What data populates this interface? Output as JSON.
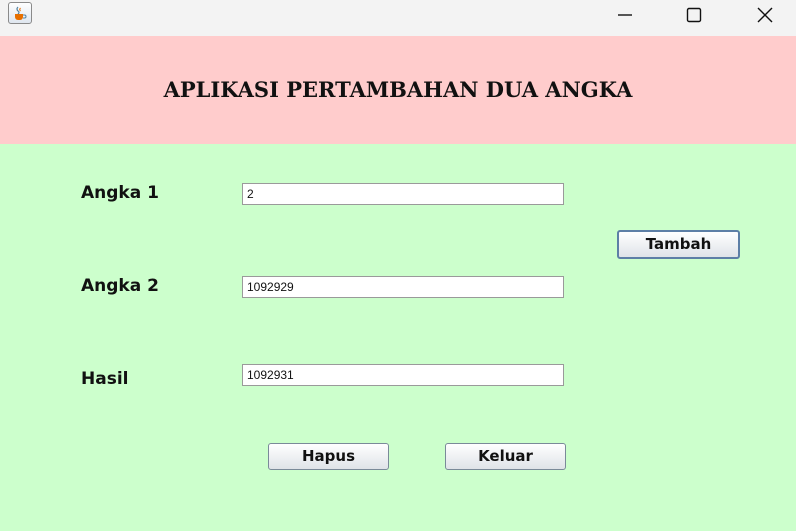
{
  "window": {
    "app_icon": "java-coffee-icon",
    "minimize_icon": "minimize-icon",
    "maximize_icon": "maximize-icon",
    "close_icon": "close-icon"
  },
  "header": {
    "title": "APLIKASI PERTAMBAHAN DUA ANGKA",
    "background": "#ffcccc"
  },
  "form": {
    "background": "#ccffcc",
    "angka1_label": "Angka 1",
    "angka1_value": "2",
    "angka2_label": "Angka 2",
    "angka2_value": "1092929",
    "hasil_label": "Hasil",
    "hasil_value": "1092931"
  },
  "buttons": {
    "tambah": "Tambah",
    "hapus": "Hapus",
    "keluar": "Keluar"
  }
}
